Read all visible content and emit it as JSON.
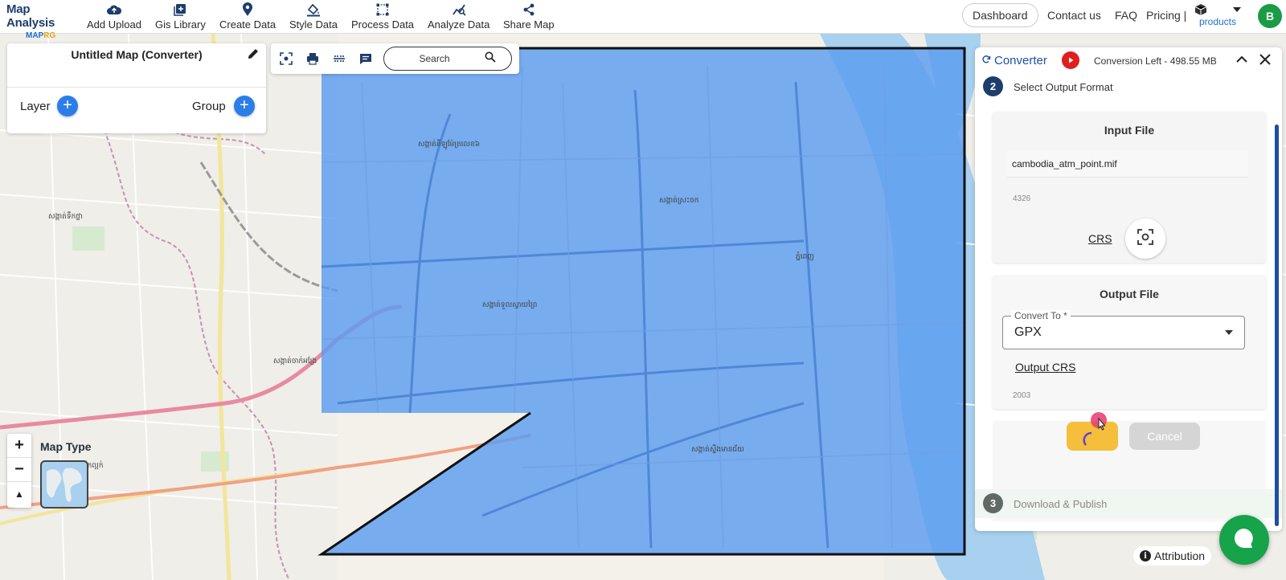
{
  "header": {
    "logo_title": "Map Analysis",
    "logo_sub_a": "MAP",
    "logo_sub_b": "RG",
    "nav": [
      {
        "label": "Add Upload",
        "icon": "cloud-upload-icon"
      },
      {
        "label": "Gis Library",
        "icon": "library-add-icon"
      },
      {
        "label": "Create Data",
        "icon": "map-pin-icon"
      },
      {
        "label": "Style Data",
        "icon": "paint-bucket-icon"
      },
      {
        "label": "Process Data",
        "icon": "polygon-edit-icon"
      },
      {
        "label": "Analyze Data",
        "icon": "analyze-icon"
      },
      {
        "label": "Share Map",
        "icon": "share-icon"
      }
    ],
    "dashboard": "Dashboard",
    "contact": "Contact us",
    "faq": "FAQ",
    "pricing": "Pricing |",
    "products": "products",
    "avatar_initial": "B"
  },
  "layer_panel": {
    "title": "Untitled Map (Converter)",
    "layer_label": "Layer",
    "group_label": "Group"
  },
  "toolbar": {
    "search_placeholder": "Search"
  },
  "map_controls": {
    "zoom_in": "+",
    "zoom_out": "−",
    "compass": "▲",
    "map_type_label": "Map Type",
    "attribution": "Attribution"
  },
  "map_labels": [
    "សង្កាត់ទឹកថ្លា",
    "សង្កាត់គីឡូម៉ែត្រលេខ៦",
    "សង្កាត់ស្រះចក",
    "ភ្នំពេញ",
    "សង្កាត់ទួលស្វាយព្រៃ",
    "សង្កាត់ចាក់អង្រែ",
    "សង្កាត់ស្ទឹងមានជ័យ",
    "សង្កាត់ទឹកល្អក់"
  ],
  "converter": {
    "title": "Converter",
    "conversion_left": "Conversion Left - 498.55 MB",
    "step2_num": "2",
    "step2_label": "Select Output Format",
    "input_title": "Input File",
    "input_file": "cambodia_atm_point.mif",
    "input_crs_num": "4326",
    "crs_label": "CRS",
    "output_title": "Output File",
    "convert_to_label": "Convert To *",
    "convert_to_value": "GPX",
    "output_crs_label": "Output CRS",
    "output_crs_num": "2003",
    "cancel_label": "Cancel",
    "step3_num": "3",
    "step3_label": "Download & Publish"
  },
  "colors": {
    "accent_blue": "#2b7de9",
    "overlay_blue": "#5b9cf0",
    "brand_navy": "#1e3d6b",
    "convert_yellow": "#f5be3b",
    "chat_green": "#16a34a"
  }
}
